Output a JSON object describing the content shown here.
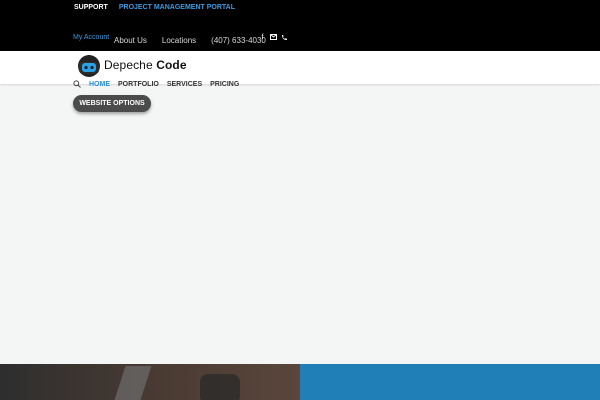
{
  "topbar": {
    "support": "SUPPORT",
    "project_portal": "PROJECT MANAGEMENT PORTAL",
    "my_account": "My Account",
    "links": [
      "About Us",
      "Locations",
      "(407) 633-4030"
    ],
    "social_icons": [
      "facebook-icon",
      "mail-icon",
      "phone-icon"
    ]
  },
  "logo": {
    "word1": "Depeche",
    "word2": "Code"
  },
  "nav": {
    "items": [
      "HOME",
      "PORTFOLIO",
      "SERVICES",
      "PRICING"
    ]
  },
  "cta": {
    "label": "WEBSITE OPTIONS"
  },
  "colors": {
    "accent": "#2a8fd3",
    "topbar_bg": "#000000",
    "panel_blue": "#1f7fb6"
  }
}
